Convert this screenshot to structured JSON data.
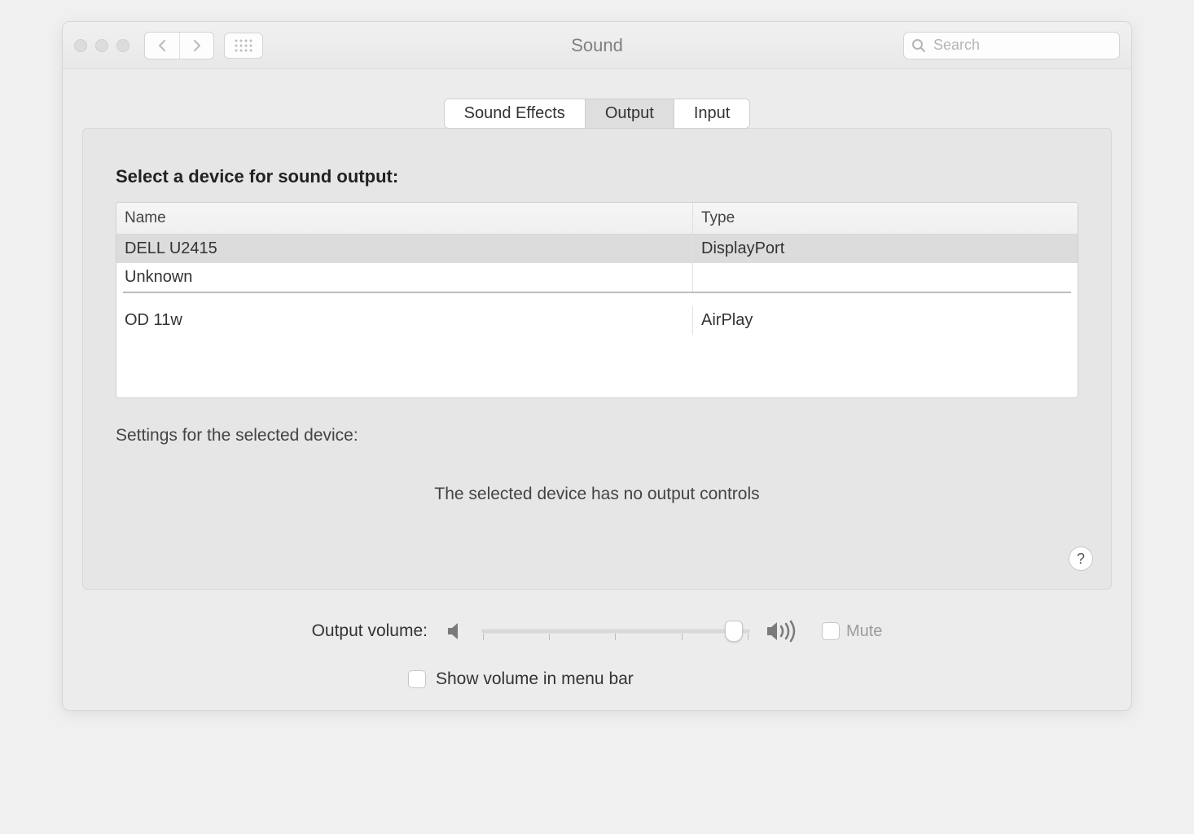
{
  "window": {
    "title": "Sound",
    "search_placeholder": "Search"
  },
  "tabs": {
    "sound_effects": "Sound Effects",
    "output": "Output",
    "input": "Input",
    "active": "output"
  },
  "panel": {
    "select_label": "Select a device for sound output:",
    "columns": {
      "name": "Name",
      "type": "Type"
    },
    "devices": [
      {
        "name": "DELL U2415",
        "type": "DisplayPort",
        "selected": true
      },
      {
        "name": "Unknown",
        "type": "",
        "selected": false
      },
      {
        "name": "OD 11w",
        "type": "AirPlay",
        "selected": false
      }
    ],
    "settings_label": "Settings for the selected device:",
    "no_controls_msg": "The selected device has no output controls",
    "help_label": "?"
  },
  "volume": {
    "label": "Output volume:",
    "percent": 94,
    "mute_label": "Mute",
    "mute_checked": false,
    "show_in_menu_label": "Show volume in menu bar",
    "show_in_menu_checked": false
  }
}
